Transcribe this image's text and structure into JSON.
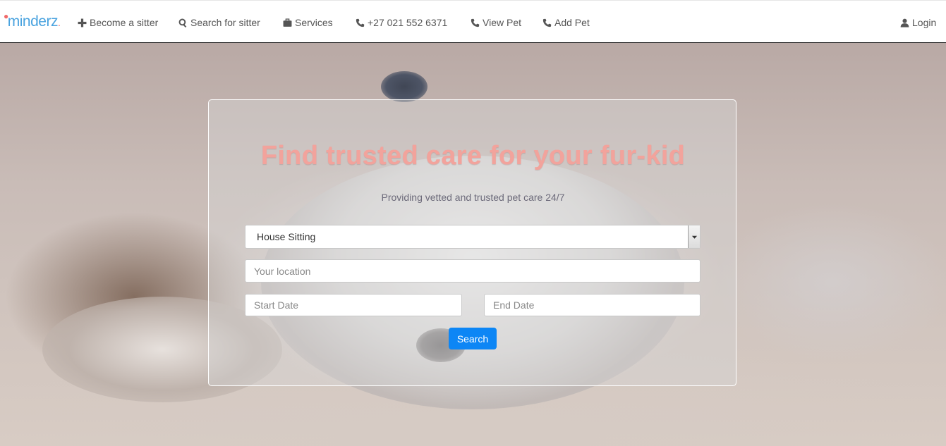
{
  "brand": {
    "name": "minderz",
    "suffix": "."
  },
  "nav": {
    "items": [
      {
        "label": "Become a sitter",
        "icon": "plus-icon"
      },
      {
        "label": "Search for sitter",
        "icon": "search-icon"
      },
      {
        "label": "Services",
        "icon": "briefcase-icon"
      },
      {
        "label": "+27 021 552 6371",
        "icon": "phone-icon"
      },
      {
        "label": "View Pet",
        "icon": "phone-icon"
      },
      {
        "label": "Add Pet",
        "icon": "phone-icon"
      }
    ],
    "login": {
      "label": "Login",
      "icon": "user-icon"
    }
  },
  "hero": {
    "headline": "Find trusted care for your fur-kid",
    "subheadline": "Providing vetted and trusted pet care 24/7",
    "service_select": {
      "selected": "House Sitting"
    },
    "location": {
      "placeholder": "Your location",
      "value": ""
    },
    "start_date": {
      "placeholder": "Start Date",
      "value": ""
    },
    "end_date": {
      "placeholder": "End Date",
      "value": ""
    },
    "search_button": "Search"
  },
  "colors": {
    "headline": "#f2a39c",
    "search_button": "#0d86f5",
    "brand_blue": "#4aa3df",
    "brand_accent": "#f06a6a"
  }
}
